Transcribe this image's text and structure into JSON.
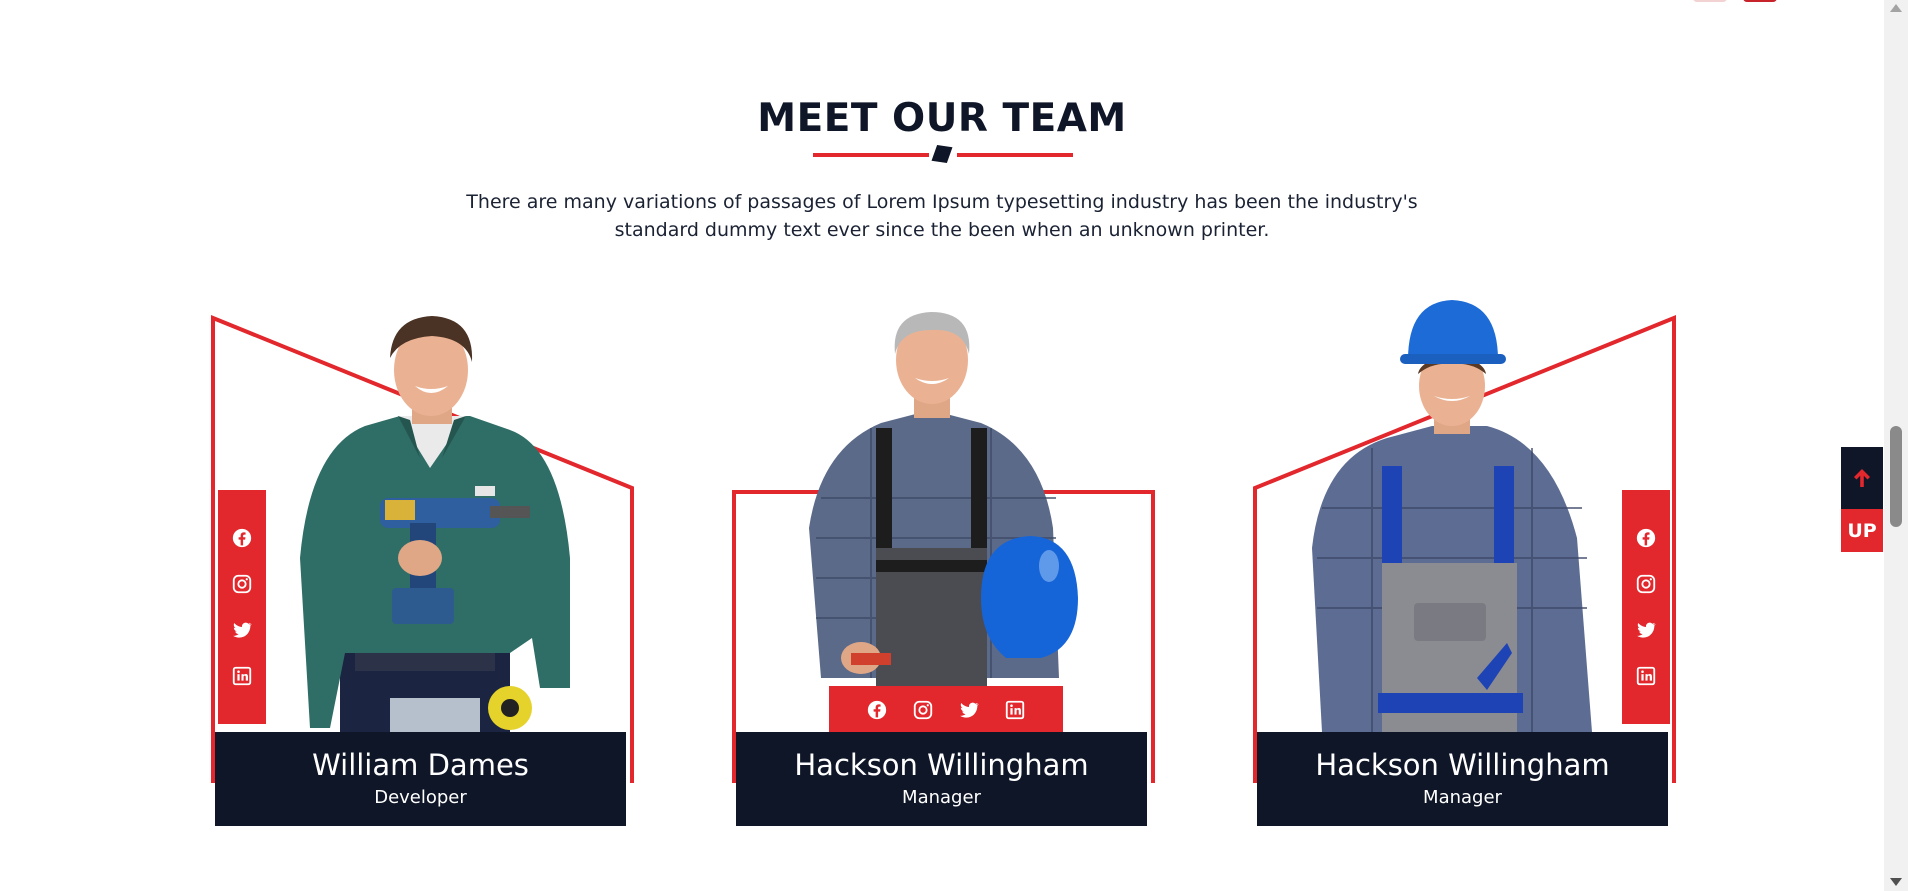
{
  "section": {
    "title": "MEET OUR TEAM",
    "intro": "There are many variations of passages of Lorem Ipsum typesetting industry has been the industry's standard dummy text ever since the been when an unknown printer."
  },
  "team": [
    {
      "name": "William Dames",
      "role": "Developer",
      "social_layout": "vertical-left",
      "frame": "slope-down-right"
    },
    {
      "name": "Hackson Willingham",
      "role": "Manager",
      "social_layout": "horizontal-bottom",
      "frame": "flat"
    },
    {
      "name": "Hackson Willingham",
      "role": "Manager",
      "social_layout": "vertical-right",
      "frame": "slope-down-left"
    }
  ],
  "social_icons": [
    "facebook-icon",
    "instagram-icon",
    "twitter-icon",
    "linkedin-icon"
  ],
  "scroll_top": {
    "label": "UP",
    "icon": "arrow-up-icon"
  },
  "colors": {
    "accent": "#e2272d",
    "dark": "#0e1628",
    "text": "#1a2233",
    "background": "#ffffff"
  }
}
